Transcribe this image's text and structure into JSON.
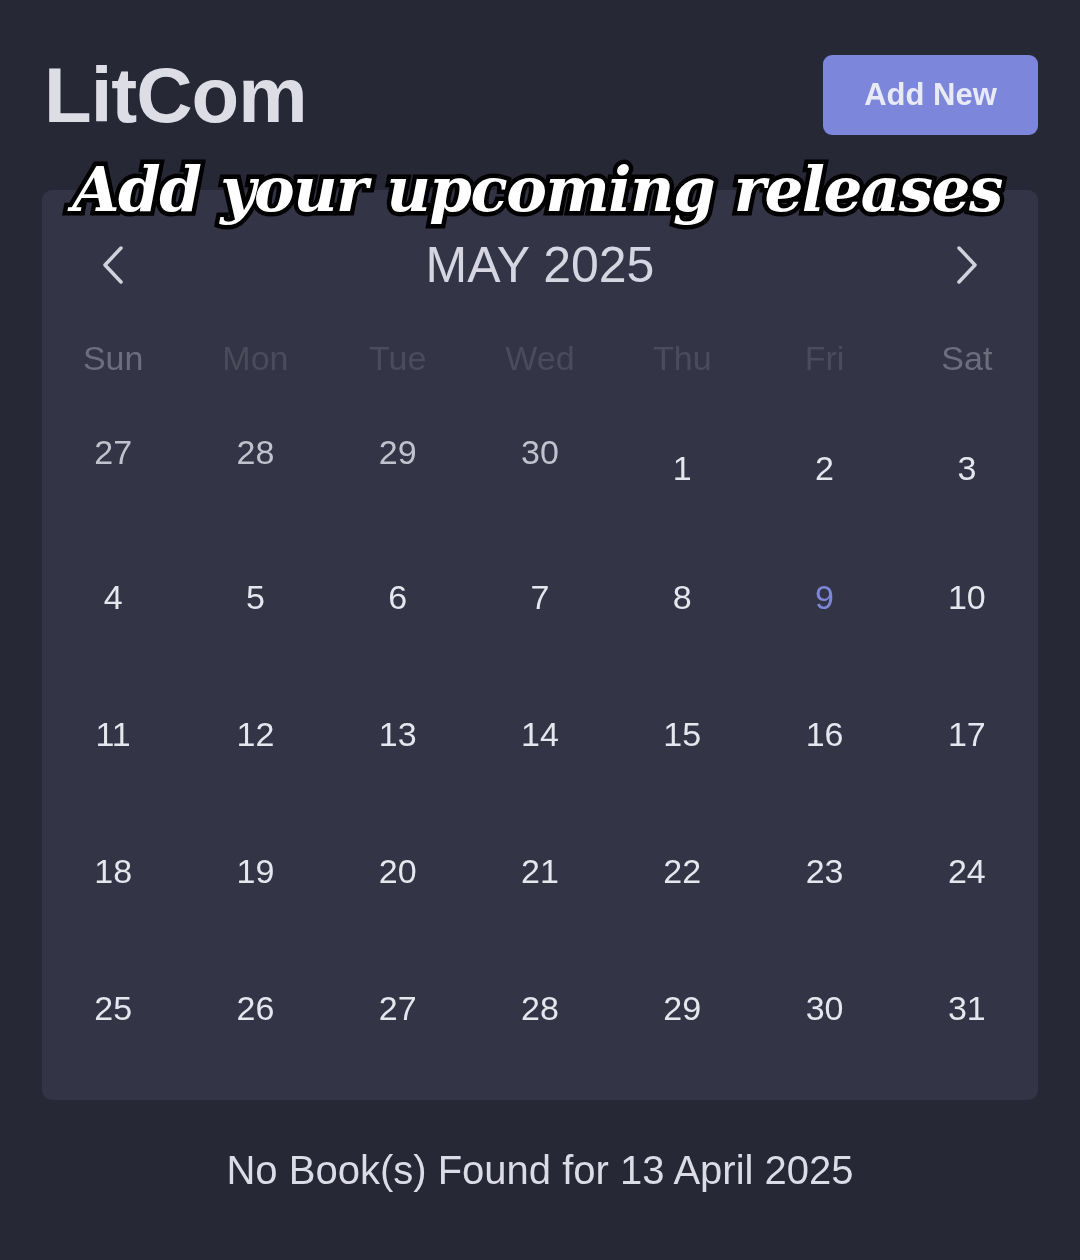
{
  "header": {
    "logo": "LitCom",
    "add_button": "Add New"
  },
  "overlay_caption": "Add your upcoming releases",
  "calendar": {
    "month_title": "MAY 2025",
    "weekdays": [
      {
        "label": "Sun",
        "weekend": true
      },
      {
        "label": "Mon",
        "weekend": false
      },
      {
        "label": "Tue",
        "weekend": false
      },
      {
        "label": "Wed",
        "weekend": false
      },
      {
        "label": "Thu",
        "weekend": false
      },
      {
        "label": "Fri",
        "weekend": false
      },
      {
        "label": "Sat",
        "weekend": true
      }
    ],
    "weeks": [
      [
        {
          "day": "27",
          "current_month": false,
          "today": false
        },
        {
          "day": "28",
          "current_month": false,
          "today": false
        },
        {
          "day": "29",
          "current_month": false,
          "today": false
        },
        {
          "day": "30",
          "current_month": false,
          "today": false
        },
        {
          "day": "1",
          "current_month": true,
          "today": false
        },
        {
          "day": "2",
          "current_month": true,
          "today": false
        },
        {
          "day": "3",
          "current_month": true,
          "today": false
        }
      ],
      [
        {
          "day": "4",
          "current_month": true,
          "today": false
        },
        {
          "day": "5",
          "current_month": true,
          "today": false
        },
        {
          "day": "6",
          "current_month": true,
          "today": false
        },
        {
          "day": "7",
          "current_month": true,
          "today": false
        },
        {
          "day": "8",
          "current_month": true,
          "today": false
        },
        {
          "day": "9",
          "current_month": true,
          "today": true
        },
        {
          "day": "10",
          "current_month": true,
          "today": false
        }
      ],
      [
        {
          "day": "11",
          "current_month": true,
          "today": false
        },
        {
          "day": "12",
          "current_month": true,
          "today": false
        },
        {
          "day": "13",
          "current_month": true,
          "today": false
        },
        {
          "day": "14",
          "current_month": true,
          "today": false
        },
        {
          "day": "15",
          "current_month": true,
          "today": false
        },
        {
          "day": "16",
          "current_month": true,
          "today": false
        },
        {
          "day": "17",
          "current_month": true,
          "today": false
        }
      ],
      [
        {
          "day": "18",
          "current_month": true,
          "today": false
        },
        {
          "day": "19",
          "current_month": true,
          "today": false
        },
        {
          "day": "20",
          "current_month": true,
          "today": false
        },
        {
          "day": "21",
          "current_month": true,
          "today": false
        },
        {
          "day": "22",
          "current_month": true,
          "today": false
        },
        {
          "day": "23",
          "current_month": true,
          "today": false
        },
        {
          "day": "24",
          "current_month": true,
          "today": false
        }
      ],
      [
        {
          "day": "25",
          "current_month": true,
          "today": false
        },
        {
          "day": "26",
          "current_month": true,
          "today": false
        },
        {
          "day": "27",
          "current_month": true,
          "today": false
        },
        {
          "day": "28",
          "current_month": true,
          "today": false
        },
        {
          "day": "29",
          "current_month": true,
          "today": false
        },
        {
          "day": "30",
          "current_month": true,
          "today": false
        },
        {
          "day": "31",
          "current_month": true,
          "today": false
        }
      ]
    ]
  },
  "status_message": "No Book(s) Found for 13 April 2025"
}
